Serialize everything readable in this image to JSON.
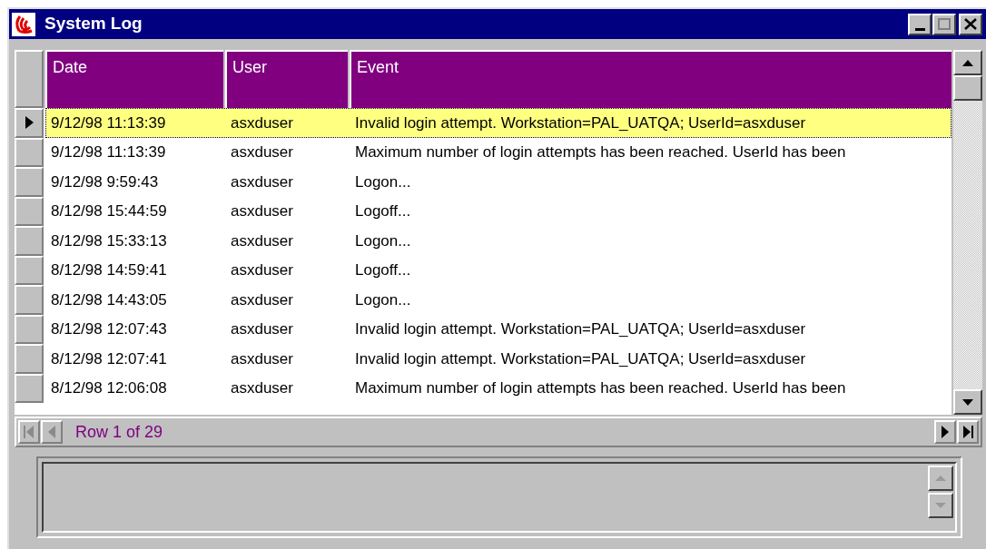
{
  "window": {
    "title": "System Log"
  },
  "table": {
    "columns": [
      "Date",
      "User",
      "Event"
    ],
    "rows": [
      {
        "selected": true,
        "cells": [
          "9/12/98 11:13:39",
          "asxduser",
          "Invalid login attempt. Workstation=PAL_UATQA; UserId=asxduser"
        ]
      },
      {
        "selected": false,
        "cells": [
          "9/12/98 11:13:39",
          "asxduser",
          "Maximum number of login attempts has been reached. UserId has been"
        ]
      },
      {
        "selected": false,
        "cells": [
          "9/12/98 9:59:43",
          "asxduser",
          "Logon..."
        ]
      },
      {
        "selected": false,
        "cells": [
          "8/12/98 15:44:59",
          "asxduser",
          "Logoff..."
        ]
      },
      {
        "selected": false,
        "cells": [
          "8/12/98 15:33:13",
          "asxduser",
          "Logon..."
        ]
      },
      {
        "selected": false,
        "cells": [
          "8/12/98 14:59:41",
          "asxduser",
          "Logoff..."
        ]
      },
      {
        "selected": false,
        "cells": [
          "8/12/98 14:43:05",
          "asxduser",
          "Logon..."
        ]
      },
      {
        "selected": false,
        "cells": [
          "8/12/98 12:07:43",
          "asxduser",
          "Invalid login attempt. Workstation=PAL_UATQA; UserId=asxduser"
        ]
      },
      {
        "selected": false,
        "cells": [
          "8/12/98 12:07:41",
          "asxduser",
          "Invalid login attempt. Workstation=PAL_UATQA; UserId=asxduser"
        ]
      },
      {
        "selected": false,
        "cells": [
          "8/12/98 12:06:08",
          "asxduser",
          "Maximum number of login attempts has been reached. UserId has been"
        ]
      }
    ]
  },
  "navigator": {
    "status": "Row 1 of 29",
    "buttons": [
      {
        "kind": "first",
        "disabled": true
      },
      {
        "kind": "prev",
        "disabled": true
      },
      {
        "kind": "next",
        "disabled": false
      },
      {
        "kind": "last",
        "disabled": false
      }
    ]
  },
  "memo": {
    "scroll_disabled": true
  }
}
